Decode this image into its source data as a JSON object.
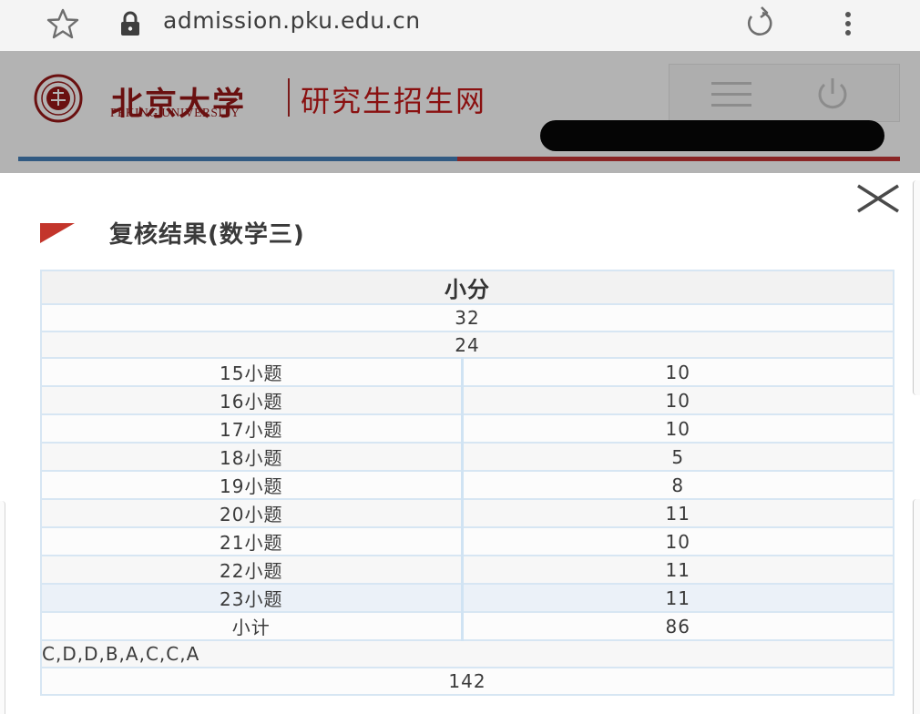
{
  "browser": {
    "url": "admission.pku.edu.cn",
    "icons": [
      "star-icon",
      "lock-icon",
      "reload-icon",
      "more-vert-icon"
    ]
  },
  "header": {
    "logo_cn": "北京大学",
    "logo_en": "PEKING UNIVERSITY",
    "site_name": "研究生招生网",
    "icons": [
      "menu-icon",
      "power-icon"
    ],
    "colors": {
      "blue_rule": "#315a82",
      "red_rule": "#8a2626",
      "brand": "#8a1010"
    }
  },
  "modal": {
    "title": "复核结果(数学三)",
    "close_icon": "close-icon",
    "table": {
      "header": "小分",
      "rows_top": [
        "32",
        "24"
      ],
      "question_rows": [
        {
          "label": "15小题",
          "value": "10"
        },
        {
          "label": "16小题",
          "value": "10"
        },
        {
          "label": "17小题",
          "value": "10"
        },
        {
          "label": "18小题",
          "value": "5"
        },
        {
          "label": "19小题",
          "value": "8"
        },
        {
          "label": "20小题",
          "value": "11"
        },
        {
          "label": "21小题",
          "value": "10"
        },
        {
          "label": "22小题",
          "value": "11"
        },
        {
          "label": "23小题",
          "value": "11"
        },
        {
          "label": "小计",
          "value": "86"
        }
      ],
      "answers": "C,D,D,B,A,C,C,A",
      "total": "142"
    }
  }
}
